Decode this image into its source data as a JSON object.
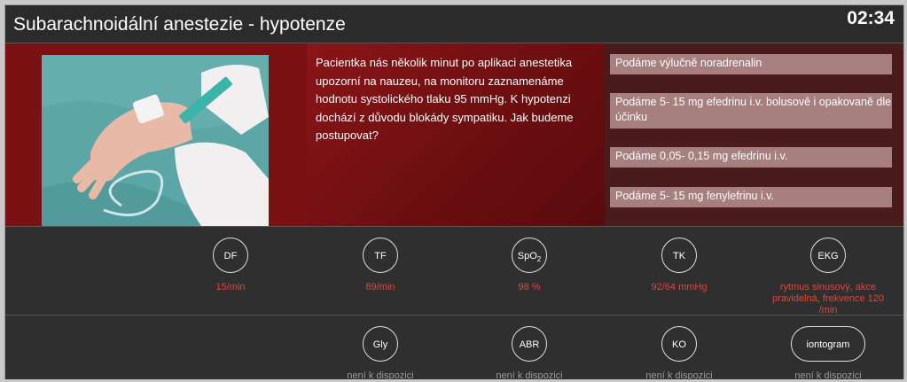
{
  "header": {
    "title": "Subarachnoidální anestezie - hypotenze",
    "timer": "02:34"
  },
  "question": "Pacientka nás několik minut po aplikaci anestetika upozorní na nauzeu, na monitoru zaznamenáme hodnotu systolického tlaku 95 mmHg. K hypotenzi dochází z důvodu blokády sympatiku. Jak budeme postupovat?",
  "answers": [
    "Podáme výlučně noradrenalin",
    "Podáme 5- 15 mg efedrinu i.v. bolusově i opakovaně dle účinku",
    "Podáme 0,05- 0,15 mg efedrinu i.v.",
    "Podáme 5- 15 mg fenylefrinu i.v."
  ],
  "vitals": [
    {
      "label": "DF",
      "value": "15/min"
    },
    {
      "label": "TF",
      "value": "89/min"
    },
    {
      "label": "SpO",
      "label_sub": "2",
      "value": "98 %"
    },
    {
      "label": "TK",
      "value": "92/64 mmHg"
    },
    {
      "label": "EKG",
      "value": "rytmus sinusový, akce pravidelná, frekvence 120 /min"
    }
  ],
  "labs": [
    {
      "label": "Gly",
      "value": "není k dispozici"
    },
    {
      "label": "ABR",
      "value": "není k dispozici"
    },
    {
      "label": "KO",
      "value": "není k dispozici"
    },
    {
      "label": "iontogram",
      "value": "není k dispozici"
    }
  ],
  "colors": {
    "vital_value": "#e0453c",
    "answer_bg": "#a77f7e",
    "panel": "#7a1214"
  },
  "icons": {
    "photo": "iv-injection-photo"
  }
}
